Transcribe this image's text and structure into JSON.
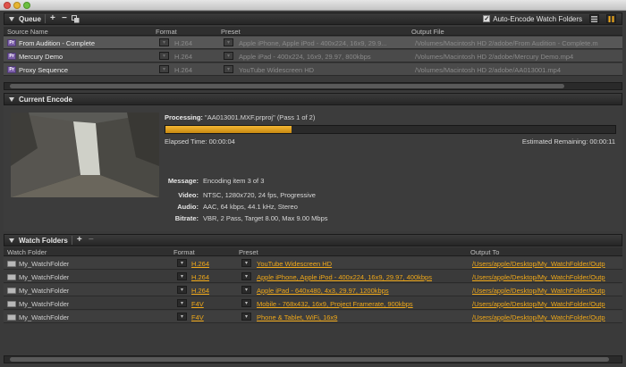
{
  "queue": {
    "title": "Queue",
    "auto_encode_label": "Auto-Encode Watch Folders",
    "auto_encode_checked": true,
    "columns": [
      "Source Name",
      "Format",
      "Preset",
      "Output File"
    ],
    "rows": [
      {
        "source": "From Audition - Complete",
        "format": "H.264",
        "preset": "Apple iPhone, Apple iPod - 400x224, 16x9, 29.9...",
        "output": "/Volumes/Macintosh HD 2/adobe/From Audition - Complete.m"
      },
      {
        "source": "Mercury Demo",
        "format": "H.264",
        "preset": "Apple iPad - 400x224, 16x9, 29.97, 800kbps",
        "output": "/Volumes/Macintosh HD 2/adobe/Mercury Demo.mp4"
      },
      {
        "source": "Proxy Sequence",
        "format": "H.264",
        "preset": "YouTube Widescreen HD",
        "output": "/Volumes/Macintosh HD 2/adobe/AA013001.mp4"
      }
    ]
  },
  "current_encode": {
    "title": "Current Encode",
    "processing_label": "Processing:",
    "processing_value": "\"AA013001.MXF.prproj\" (Pass 1 of 2)",
    "progress": 0.28,
    "elapsed": "Elapsed Time: 00:00:04",
    "remaining": "Estimated Remaining: 00:00:11",
    "message_label": "Message:",
    "message_value": "Encoding item 3 of 3",
    "video_label": "Video:",
    "video_value": "NTSC, 1280x720, 24 fps, Progressive",
    "audio_label": "Audio:",
    "audio_value": "AAC, 64 kbps, 44.1 kHz, Stereo",
    "bitrate_label": "Bitrate:",
    "bitrate_value": "VBR, 2 Pass, Target 8.00, Max 9.00 Mbps"
  },
  "watch_folders": {
    "title": "Watch Folders",
    "columns": [
      "Watch Folder",
      "Format",
      "Preset",
      "Output To"
    ],
    "rows": [
      {
        "folder": "My_WatchFolder",
        "format": "H.264",
        "preset": "YouTube Widescreen HD",
        "output": "/Users/apple/Desktop/My_WatchFolder/Outp"
      },
      {
        "folder": "My_WatchFolder",
        "format": "H.264",
        "preset": "Apple iPhone, Apple iPod - 400x224, 16x9, 29.97, 400kbps",
        "output": "/Users/apple/Desktop/My_WatchFolder/Outp"
      },
      {
        "folder": "My_WatchFolder",
        "format": "H.264",
        "preset": "Apple iPad - 640x480, 4x3, 29.97, 1200kbps",
        "output": "/Users/apple/Desktop/My_WatchFolder/Outp"
      },
      {
        "folder": "My_WatchFolder",
        "format": "F4V",
        "preset": "Mobile - 768x432, 16x9, Project Framerate, 900kbps",
        "output": "/Users/apple/Desktop/My_WatchFolder/Outp"
      },
      {
        "folder": "My_WatchFolder",
        "format": "F4V",
        "preset": "Phone & Tablet, WiFi, 16x9",
        "output": "/Users/apple/Desktop/My_WatchFolder/Outp"
      }
    ]
  },
  "colors": {
    "accent": "#f0a818",
    "panel": "#3a3a3a"
  }
}
